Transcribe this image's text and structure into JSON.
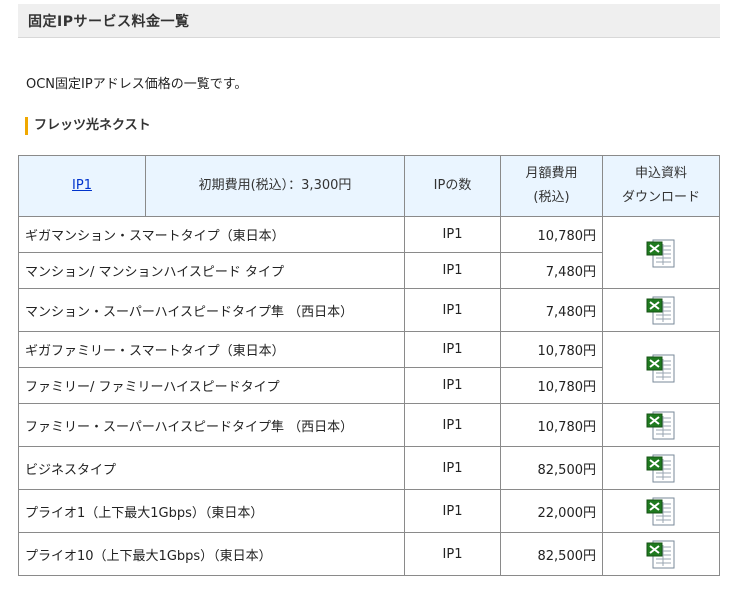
{
  "page": {
    "title": "固定IPサービス料金一覧",
    "intro": "OCN固定IPアドレス価格の一覧です。",
    "section_heading": "フレッツ光ネクスト"
  },
  "table": {
    "header": {
      "ip_link": "IP1",
      "initial_fee": "初期費用(税込）：3,300円",
      "ip_count": "IPの数",
      "monthly_fee_line1": "月額費用",
      "monthly_fee_line2": "(税込)",
      "download_line1": "申込資料",
      "download_line2": "ダウンロード"
    },
    "rows": [
      {
        "plan": "ギガマンション・スマートタイプ（東日本）",
        "ip": "IP1",
        "price": "10,780円"
      },
      {
        "plan": "マンション/ マンションハイスピード タイプ",
        "ip": "IP1",
        "price": "7,480円"
      },
      {
        "plan": "マンション・スーパーハイスピードタイプ隼 （西日本）",
        "ip": "IP1",
        "price": "7,480円"
      },
      {
        "plan": "ギガファミリー・スマートタイプ（東日本）",
        "ip": "IP1",
        "price": "10,780円"
      },
      {
        "plan": "ファミリー/ ファミリーハイスピードタイプ",
        "ip": "IP1",
        "price": "10,780円"
      },
      {
        "plan": "ファミリー・スーパーハイスピードタイプ隼 （西日本）",
        "ip": "IP1",
        "price": "10,780円"
      },
      {
        "plan": "ビジネスタイプ",
        "ip": "IP1",
        "price": "82,500円"
      },
      {
        "plan": "プライオ1（上下最大1Gbps）（東日本）",
        "ip": "IP1",
        "price": "22,000円"
      },
      {
        "plan": "プライオ10（上下最大1Gbps）（東日本）",
        "ip": "IP1",
        "price": "82,500円"
      }
    ],
    "download_icon": "excel-file-icon"
  },
  "colors": {
    "header_bg": "#efefef",
    "table_header_bg": "#eaf5ff",
    "section_accent": "#f0a800",
    "link": "#0033cc",
    "excel_green": "#1f7a1f"
  }
}
